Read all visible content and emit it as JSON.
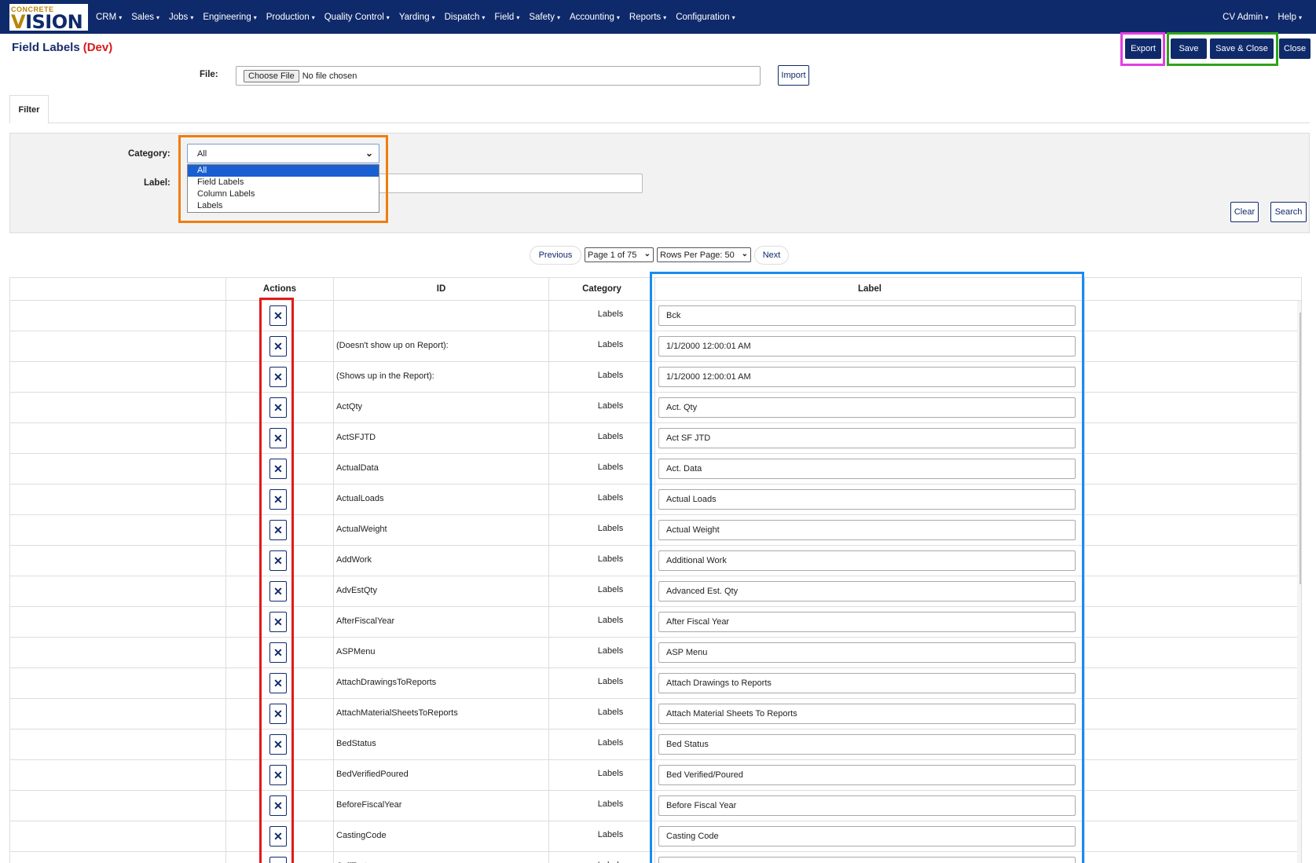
{
  "nav": {
    "logo_small": "CONCRETE",
    "logo_big_v": "V",
    "logo_big_rest": "ISION",
    "items": [
      "CRM",
      "Sales",
      "Jobs",
      "Engineering",
      "Production",
      "Quality Control",
      "Yarding",
      "Dispatch",
      "Field",
      "Safety",
      "Accounting",
      "Reports",
      "Configuration"
    ],
    "user": "CV Admin",
    "help": "Help",
    "caret": "▾"
  },
  "page": {
    "title": "Field Labels",
    "env": "(Dev)"
  },
  "toolbar": {
    "export": "Export",
    "save": "Save",
    "save_close": "Save & Close",
    "close": "Close"
  },
  "file": {
    "label": "File:",
    "choose": "Choose File",
    "status": "No file chosen",
    "import": "Import"
  },
  "tabs": {
    "filter": "Filter"
  },
  "filter": {
    "category_label": "Category:",
    "category_value": "All",
    "category_options": [
      "All",
      "Field Labels",
      "Column Labels",
      "Labels"
    ],
    "label_label": "Label:",
    "clear": "Clear",
    "search": "Search"
  },
  "pager": {
    "previous": "Previous",
    "page": "Page 1 of 75",
    "rows": "Rows Per Page: 50",
    "next": "Next"
  },
  "table": {
    "headers": {
      "actions": "Actions",
      "id": "ID",
      "category": "Category",
      "label": "Label"
    },
    "delete_glyph": "✕",
    "rows": [
      {
        "id": "",
        "category": "Labels",
        "label": "Bck"
      },
      {
        "id": "(Doesn't show up on Report):",
        "category": "Labels",
        "label": "1/1/2000 12:00:01 AM"
      },
      {
        "id": "(Shows up in the Report):",
        "category": "Labels",
        "label": "1/1/2000 12:00:01 AM"
      },
      {
        "id": "ActQty",
        "category": "Labels",
        "label": "Act. Qty"
      },
      {
        "id": "ActSFJTD",
        "category": "Labels",
        "label": "Act SF JTD"
      },
      {
        "id": "ActualData",
        "category": "Labels",
        "label": "Act. Data"
      },
      {
        "id": "ActualLoads",
        "category": "Labels",
        "label": "Actual Loads"
      },
      {
        "id": "ActualWeight",
        "category": "Labels",
        "label": "Actual Weight"
      },
      {
        "id": "AddWork",
        "category": "Labels",
        "label": "Additional Work"
      },
      {
        "id": "AdvEstQty",
        "category": "Labels",
        "label": "Advanced Est. Qty"
      },
      {
        "id": "AfterFiscalYear",
        "category": "Labels",
        "label": "After Fiscal Year"
      },
      {
        "id": "ASPMenu",
        "category": "Labels",
        "label": "ASP Menu"
      },
      {
        "id": "AttachDrawingsToReports",
        "category": "Labels",
        "label": "Attach Drawings to Reports"
      },
      {
        "id": "AttachMaterialSheetsToReports",
        "category": "Labels",
        "label": "Attach Material Sheets To Reports"
      },
      {
        "id": "BedStatus",
        "category": "Labels",
        "label": "Bed Status"
      },
      {
        "id": "BedVerifiedPoured",
        "category": "Labels",
        "label": "Bed Verified/Poured"
      },
      {
        "id": "BeforeFiscalYear",
        "category": "Labels",
        "label": "Before Fiscal Year"
      },
      {
        "id": "CastingCode",
        "category": "Labels",
        "label": "Casting Code"
      },
      {
        "id": "CellText",
        "category": "Labels",
        "label": ""
      }
    ]
  },
  "colors": {
    "nav": "#0f2a6b",
    "dev": "#d61a1a",
    "magenta": "#e23ee2",
    "green": "#2ea41a",
    "orange": "#f07d0f",
    "red": "#e01a1a",
    "blue": "#1a8cf0"
  }
}
